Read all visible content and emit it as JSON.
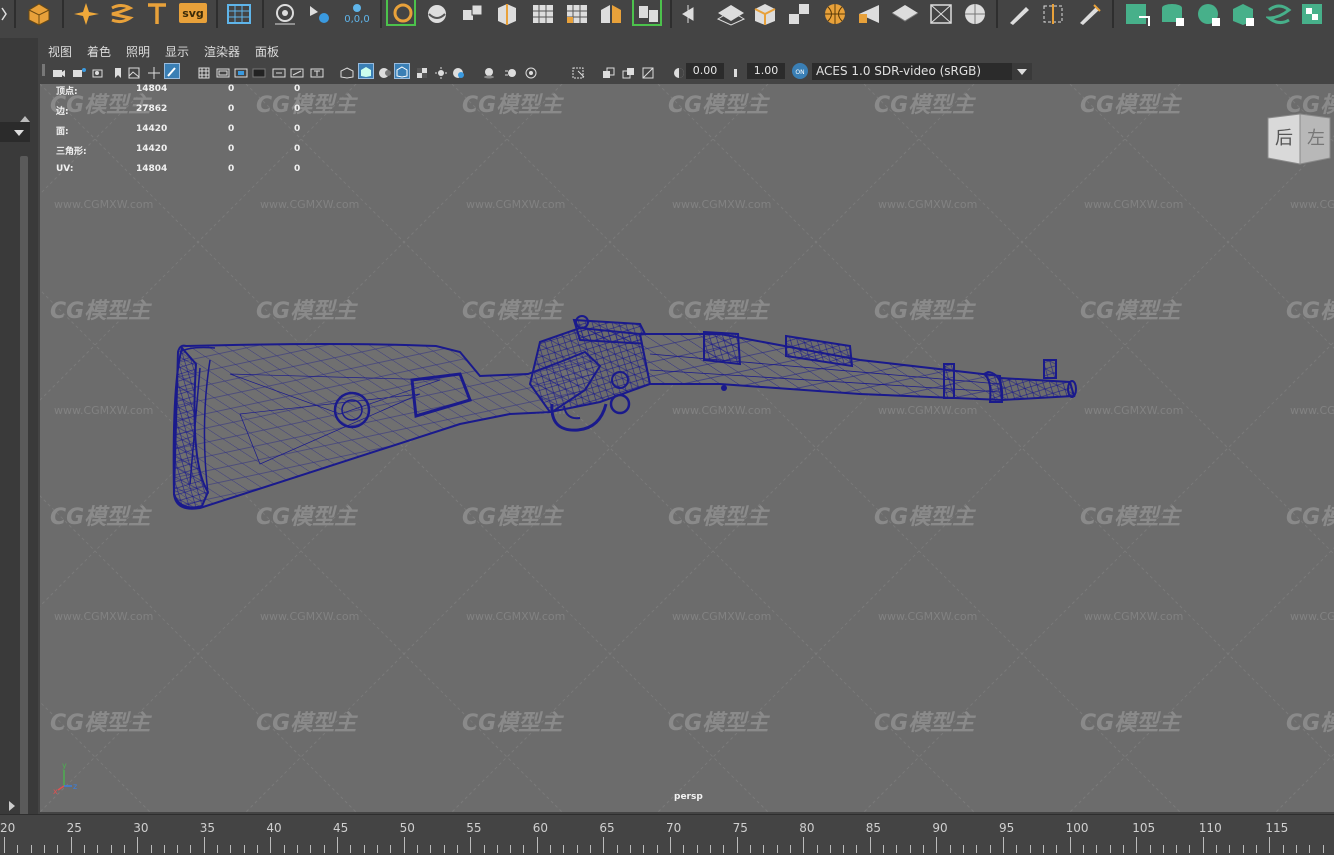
{
  "viewport_panel": {
    "menus": [
      "视图",
      "着色",
      "照明",
      "显示",
      "渲染器",
      "面板"
    ],
    "exposure_value": "0.00",
    "gamma_value": "1.00",
    "color_management_badge": "ON",
    "color_space": "ACES 1.0 SDR-video (sRGB)",
    "camera_name": "persp"
  },
  "hud_stats": [
    {
      "label": "顶点:",
      "values": [
        "14804",
        "0",
        "0"
      ]
    },
    {
      "label": "边:",
      "values": [
        "27862",
        "0",
        "0"
      ]
    },
    {
      "label": "面:",
      "values": [
        "14420",
        "0",
        "0"
      ]
    },
    {
      "label": "三角形:",
      "values": [
        "14420",
        "0",
        "0"
      ]
    },
    {
      "label": "UV:",
      "values": [
        "14804",
        "0",
        "0"
      ]
    }
  ],
  "viewcube": {
    "face_front": "后",
    "face_side": "左"
  },
  "axis_labels": {
    "x": "x",
    "y": "y",
    "z": "z"
  },
  "shelf": {
    "origin_readout": "0,0,0",
    "svg_label": "svg"
  },
  "watermark": {
    "logo_text": "CG模型主",
    "url_text": "www.CGMXW.com"
  },
  "timeline": {
    "ticks": [
      "20",
      "25",
      "30",
      "35",
      "40",
      "45",
      "50",
      "55",
      "60",
      "65",
      "70",
      "75",
      "80",
      "85",
      "90",
      "95",
      "100",
      "105",
      "110",
      "115"
    ]
  },
  "icons": [
    "poly-sphere-icon",
    "sparkle-icon",
    "spiral-icon",
    "type-tool-icon",
    "svg-tool-icon",
    "grid-icon",
    "snap-magnet-icon",
    "soft-select-icon",
    "select-icon",
    "lasso-icon",
    "cube-icon",
    "extrude-icon",
    "bevel-icon",
    "bridge-icon",
    "view-cube-icon",
    "toggle-icon",
    "settings-icon"
  ],
  "colors": {
    "wireframe": "#1a1a8c",
    "viewport_bg": "#6c6c6c",
    "selection_green": "#4cc24c",
    "accent_blue": "#3a9ae0"
  }
}
